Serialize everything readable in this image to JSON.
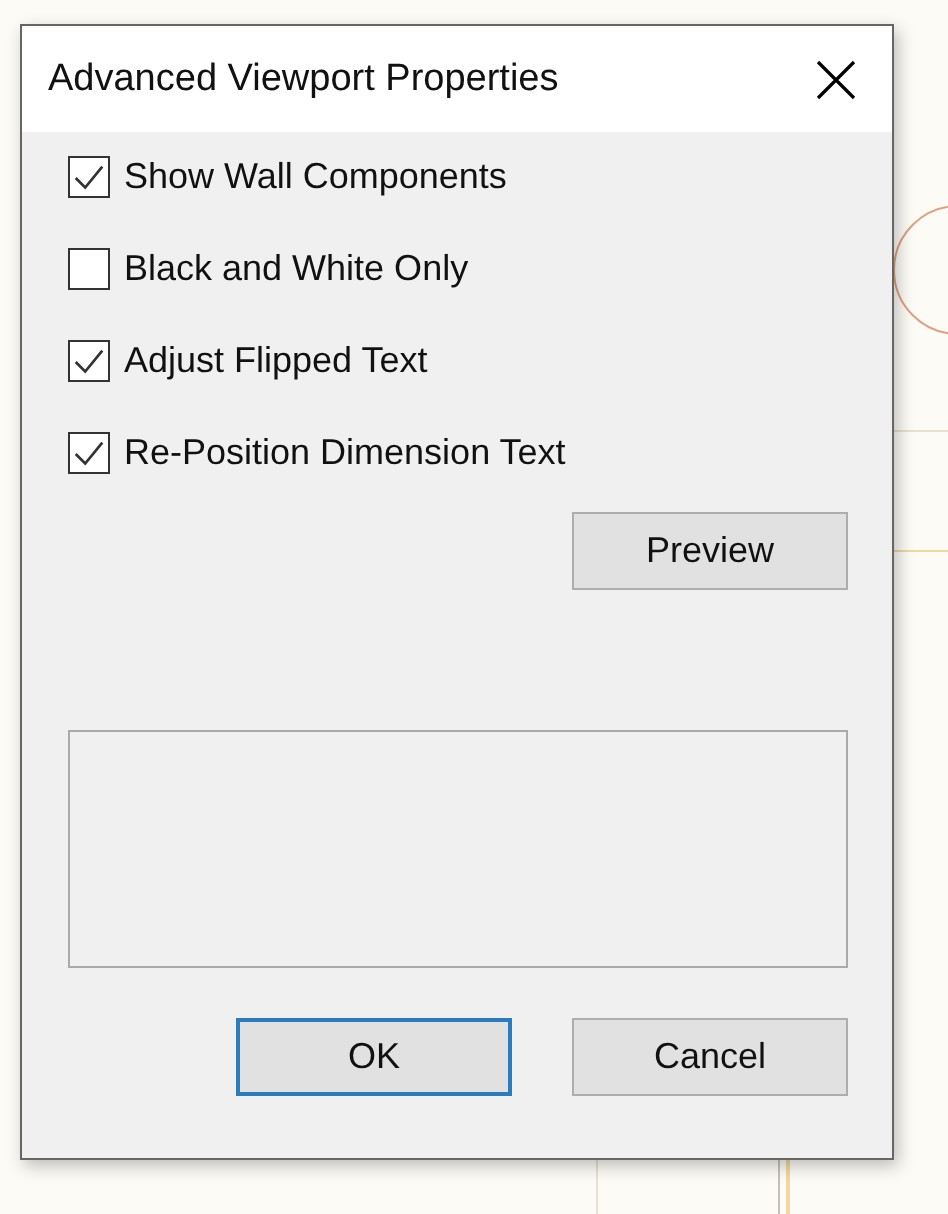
{
  "window": {
    "title": "Advanced Viewport Properties"
  },
  "options": [
    {
      "label": "Show Wall Components",
      "checked": true
    },
    {
      "label": "Black and White Only",
      "checked": false
    },
    {
      "label": "Adjust Flipped Text",
      "checked": true
    },
    {
      "label": "Re-Position Dimension Text",
      "checked": true
    }
  ],
  "preview_button": {
    "label": "Preview"
  },
  "buttons": [
    {
      "label": "OK",
      "default": true
    },
    {
      "label": "Cancel",
      "default": false
    }
  ]
}
